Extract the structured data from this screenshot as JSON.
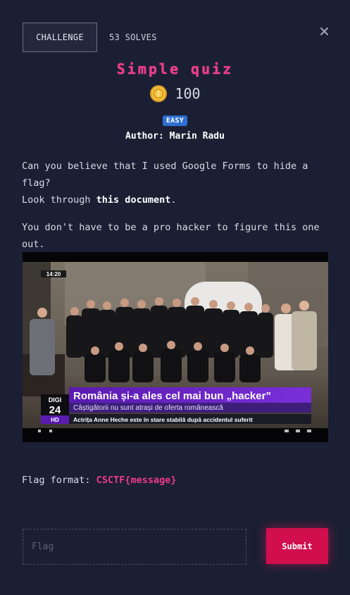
{
  "header": {
    "tab_label": "CHALLENGE",
    "solves_label": "53 SOLVES",
    "close_icon": "close-icon"
  },
  "challenge": {
    "title": "Simple quiz",
    "points": "100",
    "points_icon": "coin-icon",
    "difficulty": "EASY",
    "author": "Author: Marin Radu",
    "description": {
      "line1": "Can you believe that I used Google Forms to hide a flag?",
      "line2_prefix": "Look through ",
      "line2_link": "this document",
      "line2_suffix": ".",
      "line3": "You don't have to be a pro hacker to figure this one out."
    },
    "image": {
      "timestamp": "14:20",
      "channel_logo_top": "DIGI",
      "channel_logo_num": "24",
      "channel_logo_hd": "HD",
      "headline": "România și-a ales cel mai bun „hacker”",
      "subheadline": "Câștigătorii nu sunt atrași de oferta românească",
      "ticker": "Actrița Anne Heche este în stare stabilă după accidentul suferit"
    },
    "flag_format_label": "Flag format: ",
    "flag_format_value": "CSCTF{message}"
  },
  "form": {
    "flag_placeholder": "Flag",
    "submit_label": "Submit"
  },
  "colors": {
    "background": "#1b1f33",
    "accent": "#f03a87",
    "submit": "#d10e4e",
    "badge": "#2f6fd1"
  }
}
